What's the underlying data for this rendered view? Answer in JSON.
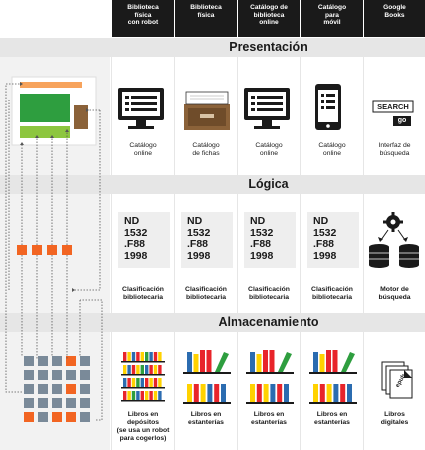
{
  "columns": [
    {
      "header": "Biblioteca\nfísica\ncon robot",
      "presentation": "",
      "logic": "",
      "storage": "Libros en\ndepósitos\n(se usa un robot\npara cogerlos)"
    },
    {
      "header": "Biblioteca\nfísica",
      "presentation": "Catálogo\nde fichas",
      "logic": "Clasificación\nbibliotecaria",
      "storage": "Libros en\nestanterías"
    },
    {
      "header": "Catálogo de\nbiblioteca\nonline",
      "presentation": "Catálogo\nonline",
      "logic": "Clasificación\nbibliotecaria",
      "storage": "Libros en\nestanterías"
    },
    {
      "header": "Catálogo\npara\nmóvil",
      "presentation": "Catálogo\nonline",
      "logic": "Clasificación\nbibliotecaria",
      "storage": "Libros en\nestanterías"
    },
    {
      "header": "Google\nBooks",
      "presentation": "Interfaz de\nbúsqueda",
      "logic": "Motor de\nbúsqueda",
      "storage": "Libros\ndigitales"
    }
  ],
  "robot_presentation": "Catálogo\nonline",
  "robot_logic": "Clasificación\nbibliotecaria",
  "bands": {
    "presentation": "Presentación",
    "logic": "Lógica",
    "storage": "Almacenamiento"
  },
  "code_text": "ND\n1532\n.F88\n1998",
  "search": {
    "label": "SEARCH",
    "go": "go"
  },
  "epub_label": "epub",
  "colors": {
    "header_bg": "#1a1a1a",
    "band_bg": "#e6e6e6",
    "orange": "#f26522",
    "green": "#2e9e3f",
    "light_green": "#8dc63f",
    "brown": "#8b6239",
    "tan": "#f7a35c",
    "grey_block": "#7a8a99",
    "red": "#e8242a",
    "yellow": "#ffd200",
    "blue": "#2b6cb0"
  }
}
